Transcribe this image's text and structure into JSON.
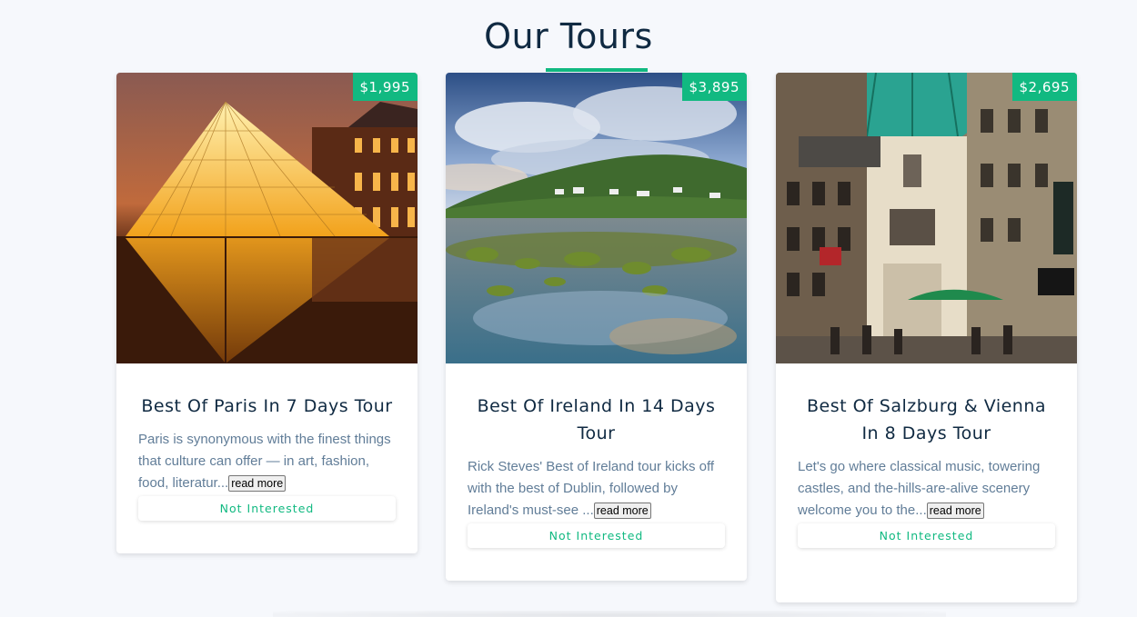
{
  "header": {
    "title": "Our Tours"
  },
  "tours": [
    {
      "price": "$1,995",
      "name": "Best Of Paris In 7 Days Tour",
      "info": "Paris is synonymous with the finest things that culture can offer — in art, fashion, food, literatur...",
      "read_more_label": "read more",
      "not_interested_label": "Not Interested",
      "image": "louvre-pyramid-photo"
    },
    {
      "price": "$3,895",
      "name": "Best Of Ireland In 14 Days Tour",
      "info": "Rick Steves' Best of Ireland tour kicks off with the best of Dublin, followed by Ireland's must-see ...",
      "read_more_label": "read more",
      "not_interested_label": "Not Interested",
      "image": "irish-coast-photo"
    },
    {
      "price": "$2,695",
      "name": "Best Of Salzburg & Vienna In 8 Days Tour",
      "info": "Let's go where classical music, towering castles, and the-hills-are-alive scenery welcome you to the...",
      "read_more_label": "read more",
      "not_interested_label": "Not Interested",
      "image": "vienna-street-photo"
    }
  ],
  "colors": {
    "accent": "#11b981",
    "background": "#f6f8fc",
    "heading": "#102a42",
    "text": "#617d98"
  }
}
